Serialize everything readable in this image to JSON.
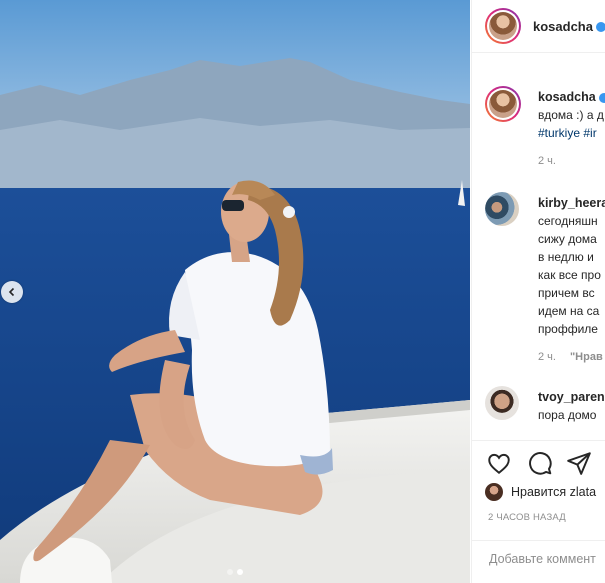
{
  "post": {
    "author": "kosadcha",
    "verified": true
  },
  "carousel": {
    "slide_count": 2,
    "active_slide": 2
  },
  "caption": {
    "username": "kosadcha",
    "text": "вдома :) а д",
    "tags": "#turkiye #ir",
    "time": "2 ч."
  },
  "comments": [
    {
      "username": "kirby_heera",
      "lines": [
        "сегодняшн",
        "сижу дома",
        "в недлю и",
        "как все про",
        "причем вс",
        "идем на са",
        "проффиле"
      ],
      "time": "2 ч.",
      "reply_label": "\"Нрав"
    },
    {
      "username": "tvoy_paren",
      "lines": [
        "пора домо"
      ]
    }
  ],
  "likes": {
    "text": "Нравится zlata"
  },
  "timestamp": "2 ЧАСОВ НАЗАД",
  "add_comment": {
    "placeholder": "Добавьте коммент"
  },
  "icons": {
    "like": "heart-icon",
    "comment": "comment-icon",
    "share": "share-icon",
    "prev": "chevron-left-icon"
  }
}
